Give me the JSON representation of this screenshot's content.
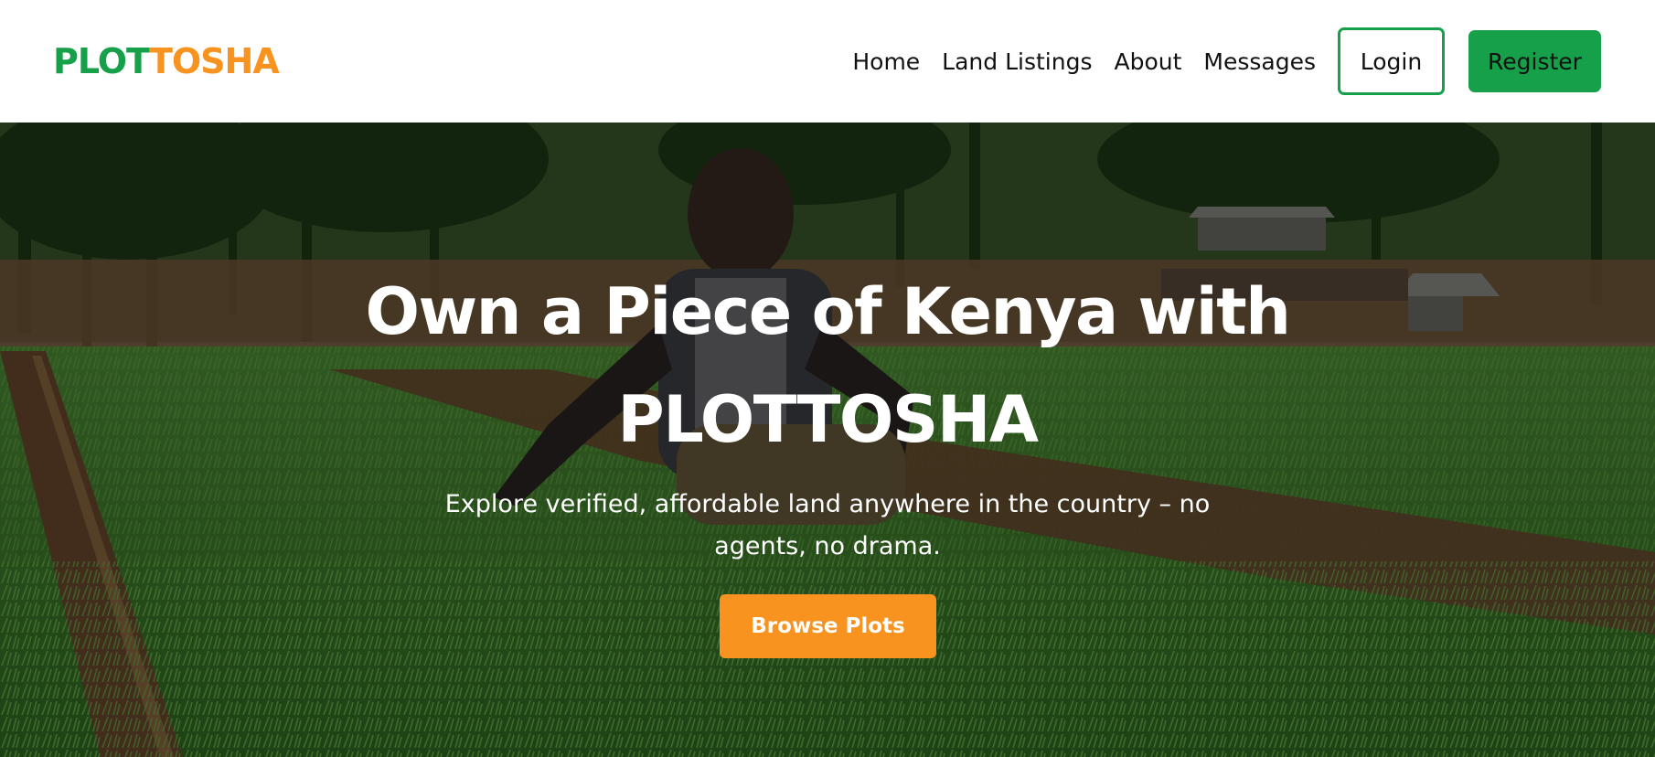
{
  "brand": {
    "logo_part1": "PLOT",
    "logo_part2": "TOSHA",
    "primary_color": "#17a04a",
    "accent_color": "#f7931e"
  },
  "nav": {
    "links": [
      "Home",
      "Land Listings",
      "About",
      "Messages"
    ],
    "login_label": "Login",
    "register_label": "Register"
  },
  "hero": {
    "title_line1": "Own a Piece of Kenya with",
    "title_line2": "PLOTTOSHA",
    "subtitle_line1": "Explore verified, affordable land anywhere in the country – no",
    "subtitle_line2": "agents, no drama.",
    "cta_label": "Browse Plots"
  }
}
